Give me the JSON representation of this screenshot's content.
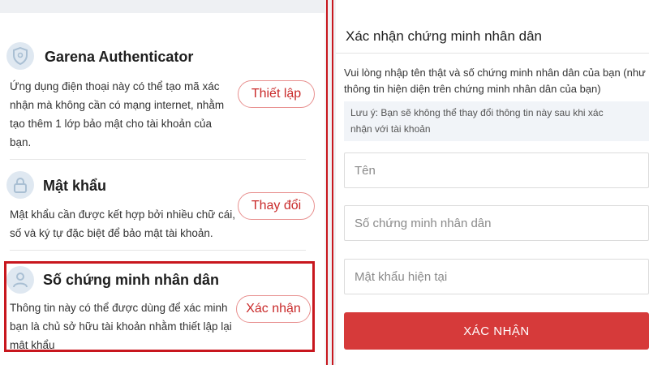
{
  "security_settings": {
    "authenticator": {
      "icon": "shield-icon",
      "title": "Garena Authenticator",
      "description_lines": [
        "Ứng dụng điện thoại này có thể tạo mã xác",
        "nhận mà không cần có mạng internet, nhằm",
        "tạo thêm 1 lớp bảo mật cho tài khoản của",
        "bạn."
      ],
      "action_label": "Thiết lập"
    },
    "password": {
      "icon": "lock-icon",
      "title": "Mật khẩu",
      "description_lines": [
        "Mật khẩu cần được kết hợp bởi nhiều chữ cái,",
        "số và ký tự đặc biệt để bảo mật tài khoản."
      ],
      "action_label": "Thay đổi"
    },
    "id_card": {
      "icon": "user-icon",
      "title": "Số chứng minh nhân dân",
      "description_lines": [
        "Thông tin này có thể được dùng để xác minh",
        "bạn là chủ sở hữu tài khoản nhằm thiết lập lại",
        "mật khẩu"
      ],
      "action_label": "Xác nhận"
    }
  },
  "id_form": {
    "title": "Xác nhận chứng minh nhân dân",
    "intro_lines": [
      "Vui lòng nhập tên thật và số chứng minh nhân dân của bạn (như",
      "thông tin hiện diện trên chứng minh nhân dân của bạn)"
    ],
    "notice_lines": [
      "Lưu ý: Bạn sẽ không thể thay đổi thông tin này sau khi xác",
      "nhận với tài khoản"
    ],
    "fields": {
      "name_placeholder": "Tên",
      "id_number_placeholder": "Số chứng minh nhân dân",
      "current_password_placeholder": "Mật khẩu hiện tại"
    },
    "submit_label": "XÁC NHẬN"
  },
  "colors": {
    "accent_red": "#c8171e",
    "button_red": "#d63a3a",
    "icon_bg": "#dfe8f1",
    "icon_fg": "#a9bfd3"
  }
}
